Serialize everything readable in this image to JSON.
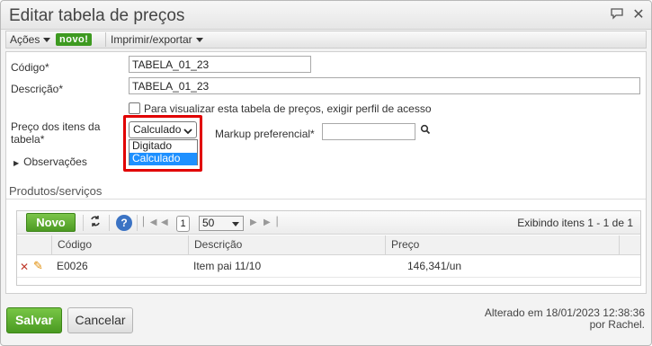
{
  "dialog": {
    "title": "Editar tabela de preços",
    "chat_icon": "speech-bubble-icon",
    "close_icon": "close-icon"
  },
  "menubar": {
    "actions_label": "Ações",
    "new_badge": "novo!",
    "print_export_label": "Imprimir/exportar"
  },
  "form": {
    "code_label": "Código*",
    "code_value": "TABELA_01_23",
    "description_label": "Descrição*",
    "description_value": "TABELA_01_23",
    "access_checkbox_label": "Para visualizar esta tabela de preços, exigir perfil de acesso",
    "access_checkbox_checked": false,
    "item_price_label_line1": "Preço dos itens da",
    "item_price_label_line2": "tabela*",
    "item_price_selected": "Calculado",
    "item_price_options": [
      "Digitado",
      "Calculado"
    ],
    "markup_label": "Markup preferencial*",
    "markup_value": "",
    "observations_label": "Observações"
  },
  "products": {
    "section_title": "Produtos/serviços",
    "new_button": "Novo",
    "page_number": "1",
    "page_size": "50",
    "showing_text": "Exibindo itens 1 - 1 de 1",
    "columns": [
      "Código",
      "Descrição",
      "Preço"
    ],
    "rows": [
      {
        "code": "E0026",
        "description": "Item pai 11/10",
        "price": "146,341/un"
      }
    ]
  },
  "footer": {
    "save_button": "Salvar",
    "cancel_button": "Cancelar",
    "audit_line1": "Alterado em 18/01/2023 12:38:36",
    "audit_line2": "por Rachel."
  },
  "colors": {
    "accent_green": "#4c9a23",
    "highlight_red": "#e10000",
    "selected_option": "#1e90ff"
  }
}
